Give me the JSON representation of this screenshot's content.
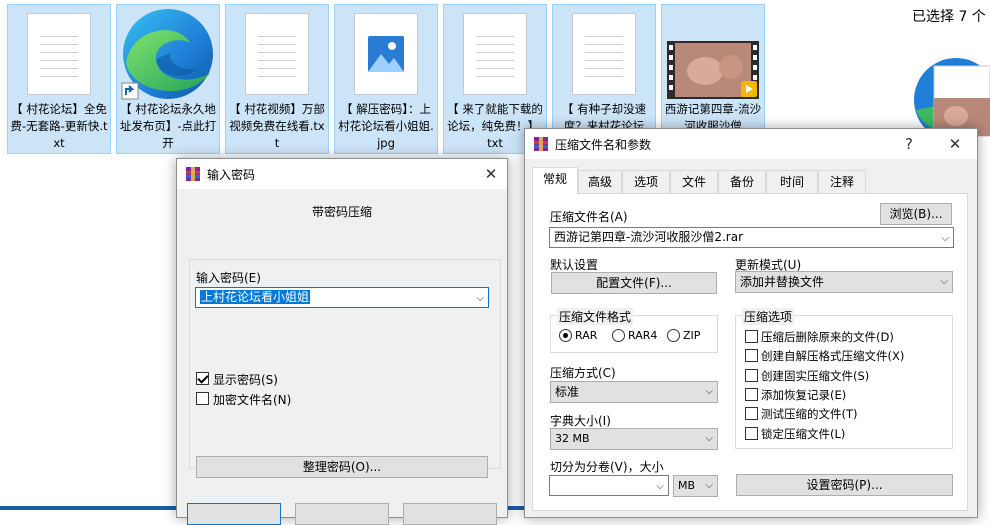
{
  "explorer": {
    "files": [
      {
        "caption": "【 村花论坛】全免费-无套路-更新快.txt",
        "type": "txt"
      },
      {
        "caption": "【 村花论坛永久地址发布页】-点此打开",
        "type": "edge"
      },
      {
        "caption": "【 村花视频】万部视频免费在线看.txt",
        "type": "txt"
      },
      {
        "caption": "【 解压密码】：上村花论坛看小姐姐.jpg",
        "type": "image"
      },
      {
        "caption": "【 来了就能下载的论坛，纯免费！】.txt",
        "type": "txt"
      },
      {
        "caption": "【 有种子却没速度？来村花论坛",
        "type": "txt"
      },
      {
        "caption": "西游记第四章-流沙河收服沙僧",
        "type": "video"
      }
    ],
    "selection_text": "已选择 7 个"
  },
  "password_dialog": {
    "title": "输入密码",
    "heading": "带密码压缩",
    "password_label": "输入密码(E)",
    "password_value": "上村花论坛看小姐姐",
    "show_password_label": "显示密码(S)",
    "show_password_checked": true,
    "encrypt_names_label": "加密文件名(N)",
    "encrypt_names_checked": false,
    "organize_button": "整理密码(O)..."
  },
  "archive_dialog": {
    "title": "压缩文件名和参数",
    "help_glyph": "?",
    "close_glyph": "✕",
    "tabs": [
      "常规",
      "高级",
      "选项",
      "文件",
      "备份",
      "时间",
      "注释"
    ],
    "active_tab": "常规",
    "archive_name_label": "压缩文件名(A)",
    "archive_name_value": "西游记第四章-流沙河收服沙僧2.rar",
    "browse_button": "浏览(B)...",
    "default_settings_label": "默认设置",
    "profiles_button": "配置文件(F)...",
    "update_mode_label": "更新模式(U)",
    "update_mode_value": "添加并替换文件",
    "format_group_title": "压缩文件格式",
    "formats": [
      {
        "label": "RAR",
        "checked": true
      },
      {
        "label": "RAR4",
        "checked": false
      },
      {
        "label": "ZIP",
        "checked": false
      }
    ],
    "method_label": "压缩方式(C)",
    "method_value": "标准",
    "dict_label": "字典大小(I)",
    "dict_value": "32 MB",
    "split_label": "切分为分卷(V)，大小",
    "split_value": "",
    "split_unit": "MB",
    "options_group_title": "压缩选项",
    "options": [
      {
        "label": "压缩后删除原来的文件(D)",
        "checked": false
      },
      {
        "label": "创建自解压格式压缩文件(X)",
        "checked": false
      },
      {
        "label": "创建固实压缩文件(S)",
        "checked": false
      },
      {
        "label": "添加恢复记录(E)",
        "checked": false
      },
      {
        "label": "测试压缩的文件(T)",
        "checked": false
      },
      {
        "label": "锁定压缩文件(L)",
        "checked": false
      }
    ],
    "set_password_button": "设置密码(P)..."
  },
  "colors": {
    "selection_bg": "#cce4f7",
    "selection_border": "#99d1ff",
    "highlight": "#0078d7",
    "dialog_bg": "#f0f0f0"
  }
}
